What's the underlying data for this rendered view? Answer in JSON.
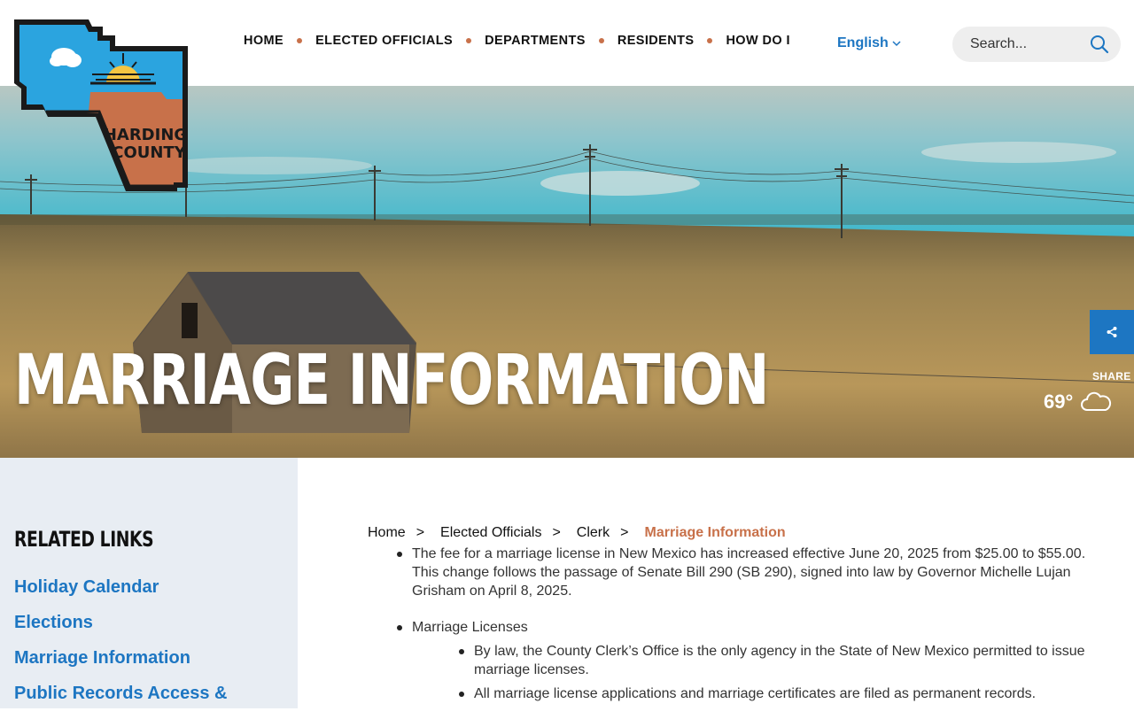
{
  "site": {
    "logo_text_line1": "HARDING",
    "logo_text_line2": "COUNTY"
  },
  "nav": {
    "items": [
      {
        "label": "HOME"
      },
      {
        "label": "ELECTED OFFICIALS"
      },
      {
        "label": "DEPARTMENTS"
      },
      {
        "label": "RESIDENTS"
      },
      {
        "label": "HOW DO I"
      }
    ]
  },
  "language": {
    "selected": "English"
  },
  "search": {
    "placeholder": "Search..."
  },
  "hero": {
    "title": "MARRIAGE INFORMATION",
    "share_label": "SHARE",
    "temperature": "69°",
    "weather_icon": "cloud-icon"
  },
  "sidebar": {
    "title": "RELATED LINKS",
    "links": [
      {
        "label": "Holiday Calendar"
      },
      {
        "label": "Elections"
      },
      {
        "label": "Marriage Information"
      },
      {
        "label": "Public Records Access &"
      }
    ]
  },
  "breadcrumb": {
    "items": [
      {
        "label": "Home"
      },
      {
        "label": "Elected Officials"
      },
      {
        "label": "Clerk"
      }
    ],
    "separator": ">",
    "current": "Marriage Information"
  },
  "content": {
    "bullet1": "The fee for a marriage license in New Mexico has increased effective June 20, 2025 from $25.00 to $55.00. This change follows the passage of Senate Bill 290 (SB 290), signed into law by Governor Michelle Lujan Grisham on April 8, 2025.",
    "bullet2": "Marriage Licenses",
    "sub_bullets": [
      "By law, the County Clerk’s Office is the only agency in the State of New Mexico permitted to issue marriage licenses.",
      "All marriage license applications and marriage certificates are filed as permanent records."
    ]
  },
  "colors": {
    "accent_blue": "#1d76c2",
    "accent_orange": "#c8714a"
  }
}
